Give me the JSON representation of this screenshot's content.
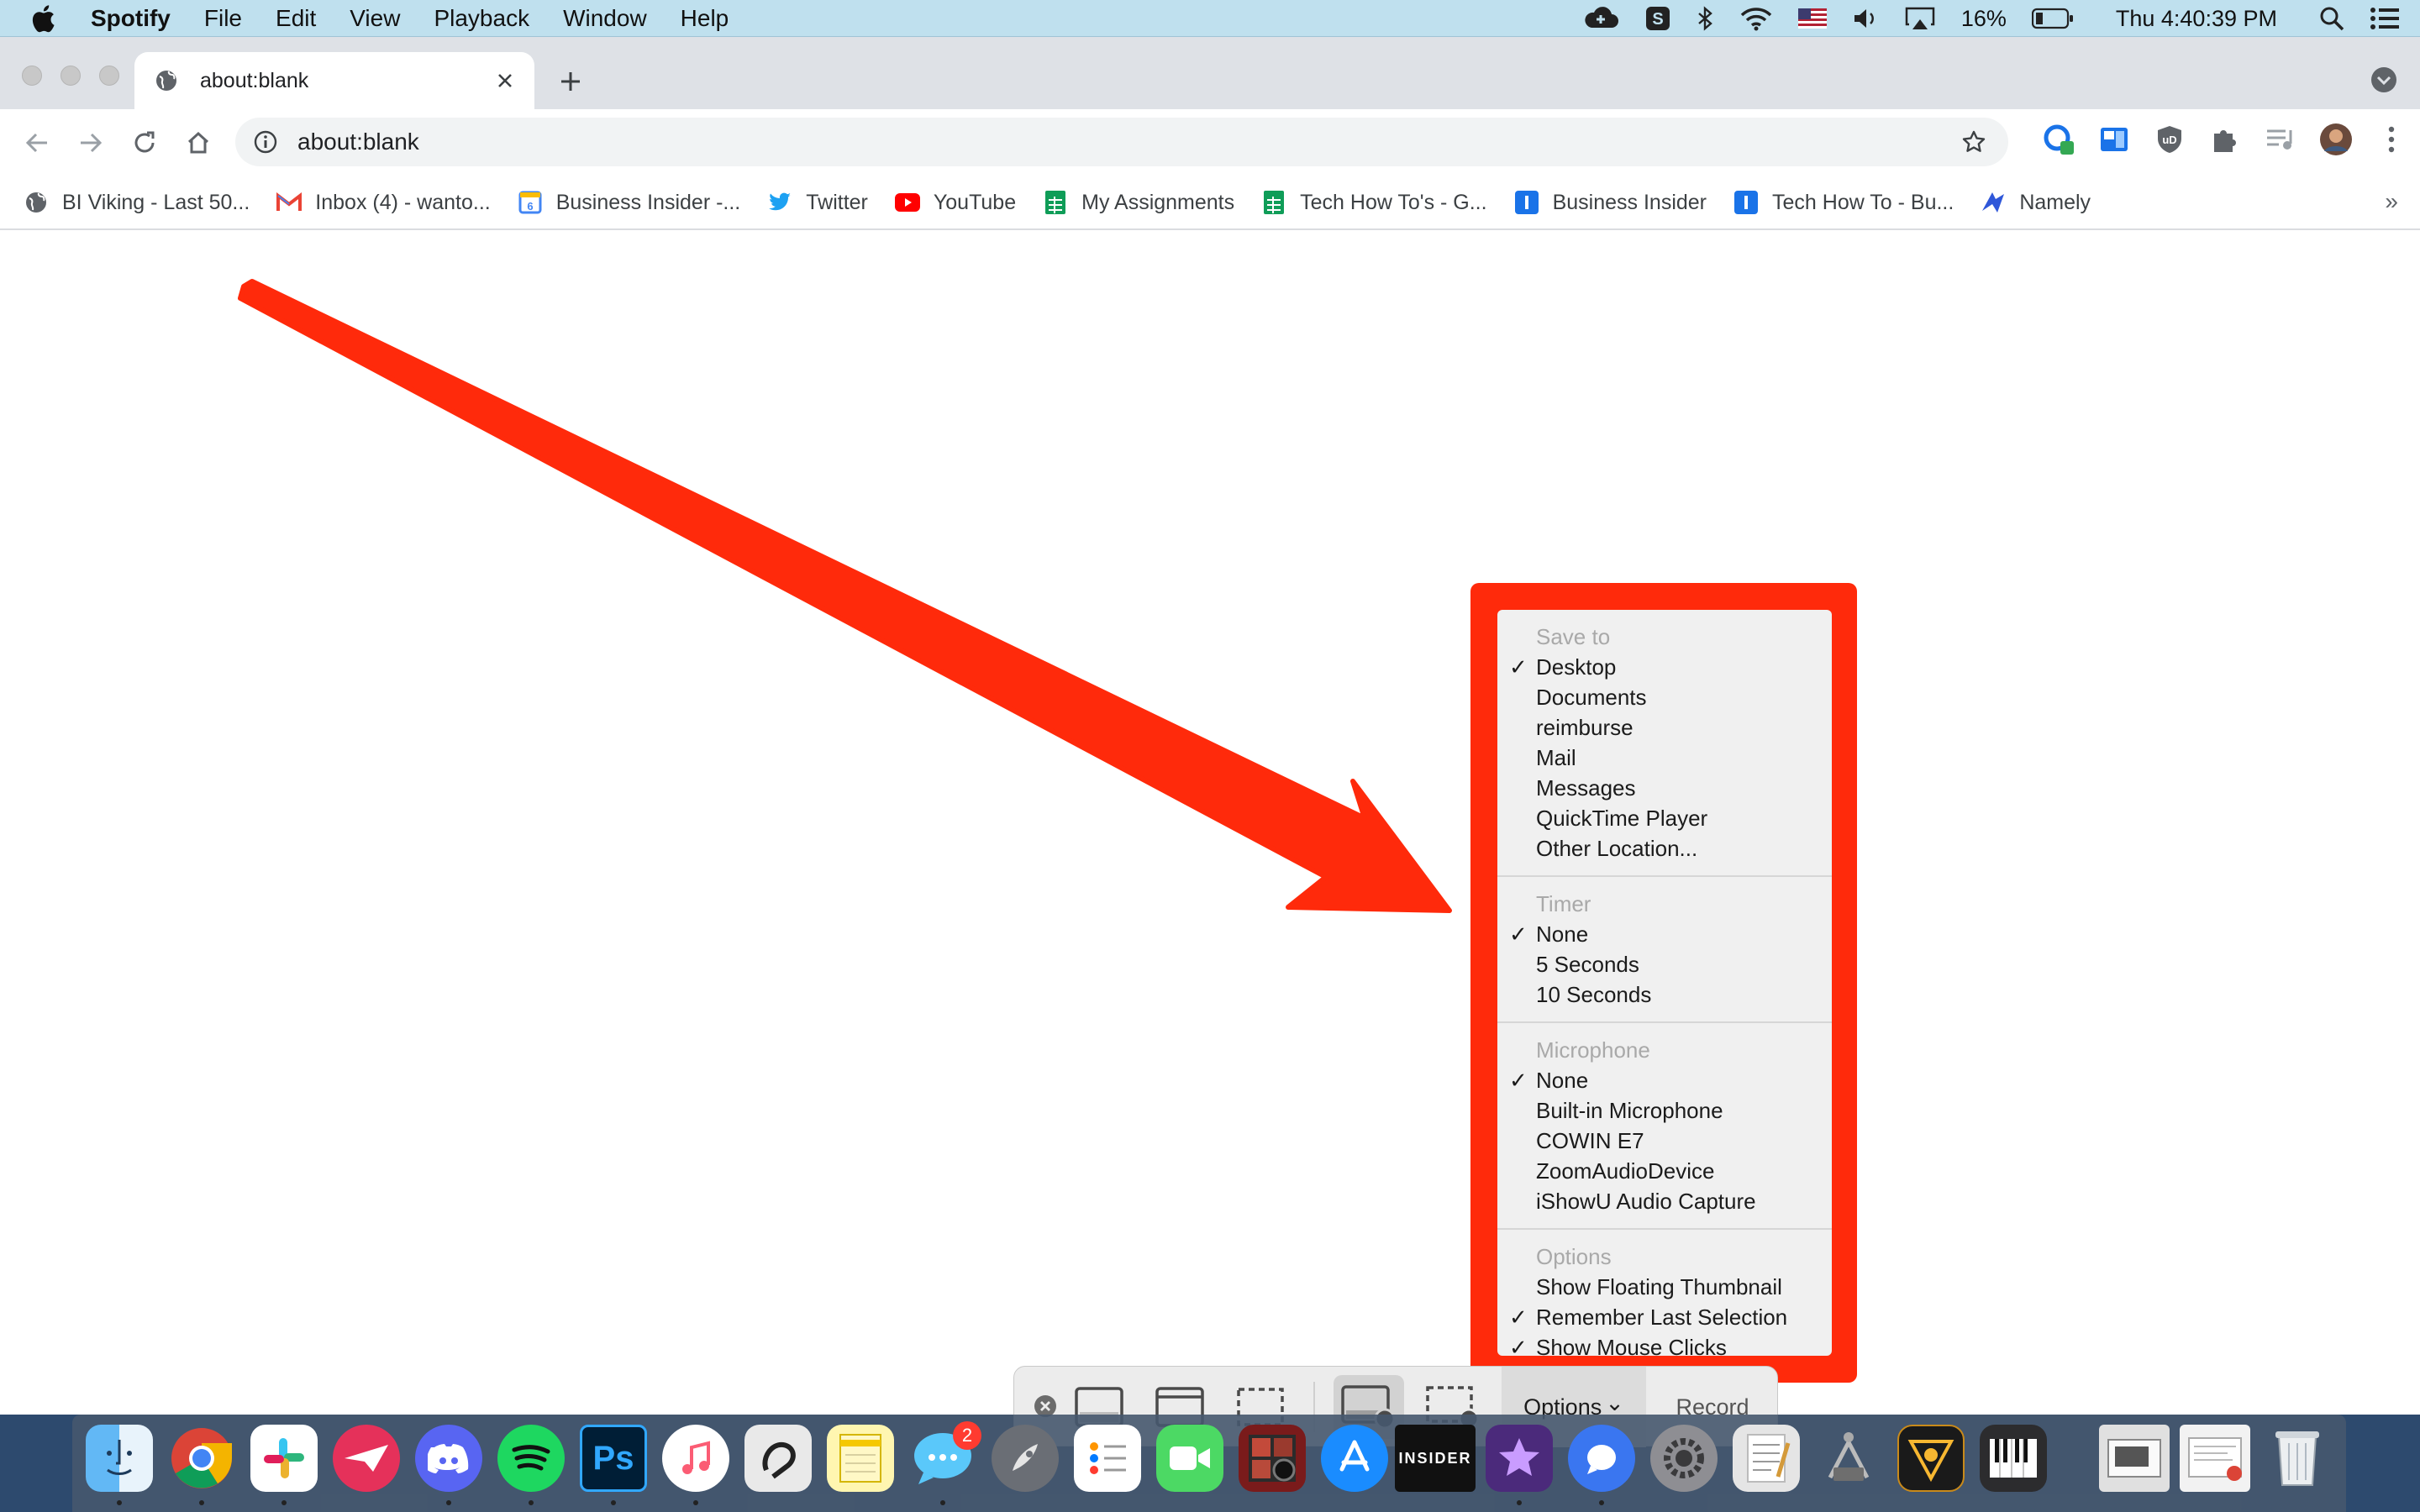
{
  "menubar": {
    "app_name": "Spotify",
    "items": [
      "File",
      "Edit",
      "View",
      "Playback",
      "Window",
      "Help"
    ],
    "battery": "16%",
    "clock": "Thu 4:40:39 PM"
  },
  "browser": {
    "tab_title": "about:blank",
    "url": "about:blank",
    "bookmarks": [
      {
        "label": "BI Viking - Last 50...",
        "icon": "globe-icon",
        "color": "#5f6368"
      },
      {
        "label": "Inbox (4) - wanto...",
        "icon": "gmail-icon",
        "color": "#ea4335"
      },
      {
        "label": "Business Insider -...",
        "icon": "google-calendar-icon",
        "color": "#4285f4"
      },
      {
        "label": "Twitter",
        "icon": "twitter-icon",
        "color": "#1da1f2"
      },
      {
        "label": "YouTube",
        "icon": "youtube-icon",
        "color": "#ff0000"
      },
      {
        "label": "My Assignments",
        "icon": "google-sheets-icon",
        "color": "#0f9d58"
      },
      {
        "label": "Tech How To's - G...",
        "icon": "google-sheets-icon",
        "color": "#0f9d58"
      },
      {
        "label": "Business Insider",
        "icon": "insider-icon",
        "color": "#1a73e8"
      },
      {
        "label": "Tech How To - Bu...",
        "icon": "insider-icon",
        "color": "#1a73e8"
      },
      {
        "label": "Namely",
        "icon": "namely-icon",
        "color": "#2f57d9"
      }
    ],
    "bookmarks_overflow": "»"
  },
  "options_menu": {
    "sections": [
      {
        "heading": "Save to",
        "items": [
          {
            "label": "Desktop",
            "checked": true
          },
          {
            "label": "Documents",
            "checked": false
          },
          {
            "label": "reimburse",
            "checked": false
          },
          {
            "label": "Mail",
            "checked": false
          },
          {
            "label": "Messages",
            "checked": false
          },
          {
            "label": "QuickTime Player",
            "checked": false
          },
          {
            "label": "Other Location...",
            "checked": false
          }
        ]
      },
      {
        "heading": "Timer",
        "items": [
          {
            "label": "None",
            "checked": true
          },
          {
            "label": "5 Seconds",
            "checked": false
          },
          {
            "label": "10 Seconds",
            "checked": false
          }
        ]
      },
      {
        "heading": "Microphone",
        "items": [
          {
            "label": "None",
            "checked": true
          },
          {
            "label": "Built-in Microphone",
            "checked": false
          },
          {
            "label": "COWIN E7",
            "checked": false
          },
          {
            "label": "ZoomAudioDevice",
            "checked": false
          },
          {
            "label": "iShowU Audio Capture",
            "checked": false
          }
        ]
      },
      {
        "heading": "Options",
        "items": [
          {
            "label": "Show Floating Thumbnail",
            "checked": false
          },
          {
            "label": "Remember Last Selection",
            "checked": true
          },
          {
            "label": "Show Mouse Clicks",
            "checked": true
          }
        ]
      }
    ],
    "check_glyph": "✓"
  },
  "capture_toolbar": {
    "options_label": "Options",
    "options_chevron": "⌄",
    "record_label": "Record"
  },
  "dock": {
    "messages_badge": "2",
    "insider_label": "INSIDER"
  },
  "colors": {
    "highlight": "#ff2a0b",
    "menubar": "#bfe0ee",
    "tabstrip": "#dee1e6"
  }
}
